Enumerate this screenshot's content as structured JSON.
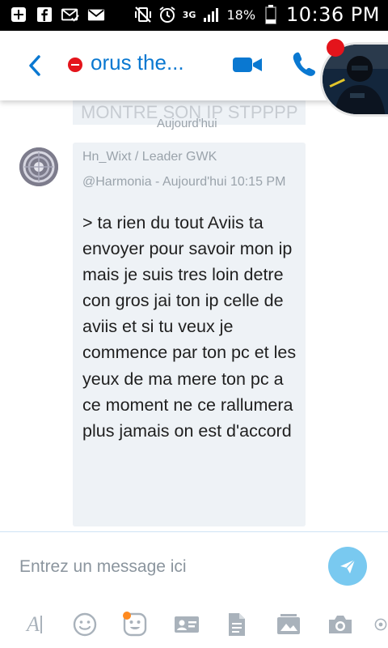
{
  "status_bar": {
    "network": "3G",
    "battery": "18%",
    "clock": "10:36 PM"
  },
  "header": {
    "title": "orus the..."
  },
  "chat": {
    "previous_message_fragment": "MONTRE SON IP STPPPP",
    "date_separator": "Aujourd'hui",
    "message": {
      "sender": "Hn_Wixt / Leader GWK",
      "meta": "@Harmonia - Aujourd'hui 10:15 PM",
      "text": "> ta rien du tout Aviis ta envoyer pour savoir mon ip mais je suis tres loin detre con gros jai ton ip celle de aviis et si tu veux je commence par ton pc et les yeux de ma mere ton pc a ce moment ne ce rallumera plus jamais on est d'accord"
    }
  },
  "composer": {
    "placeholder": "Entrez un message ici"
  },
  "toolbar": {
    "format_label": "A",
    "items": [
      "format-text-icon",
      "emoji-icon",
      "mojis-icon",
      "contact-card-icon",
      "file-icon",
      "media-album-icon",
      "camera-icon",
      "location-icon"
    ]
  },
  "colors": {
    "accent": "#0a78d1",
    "bubble": "#eef2f6",
    "send": "#79c9f0",
    "presence": "#e4141b",
    "notification": "#ff8a1f"
  }
}
